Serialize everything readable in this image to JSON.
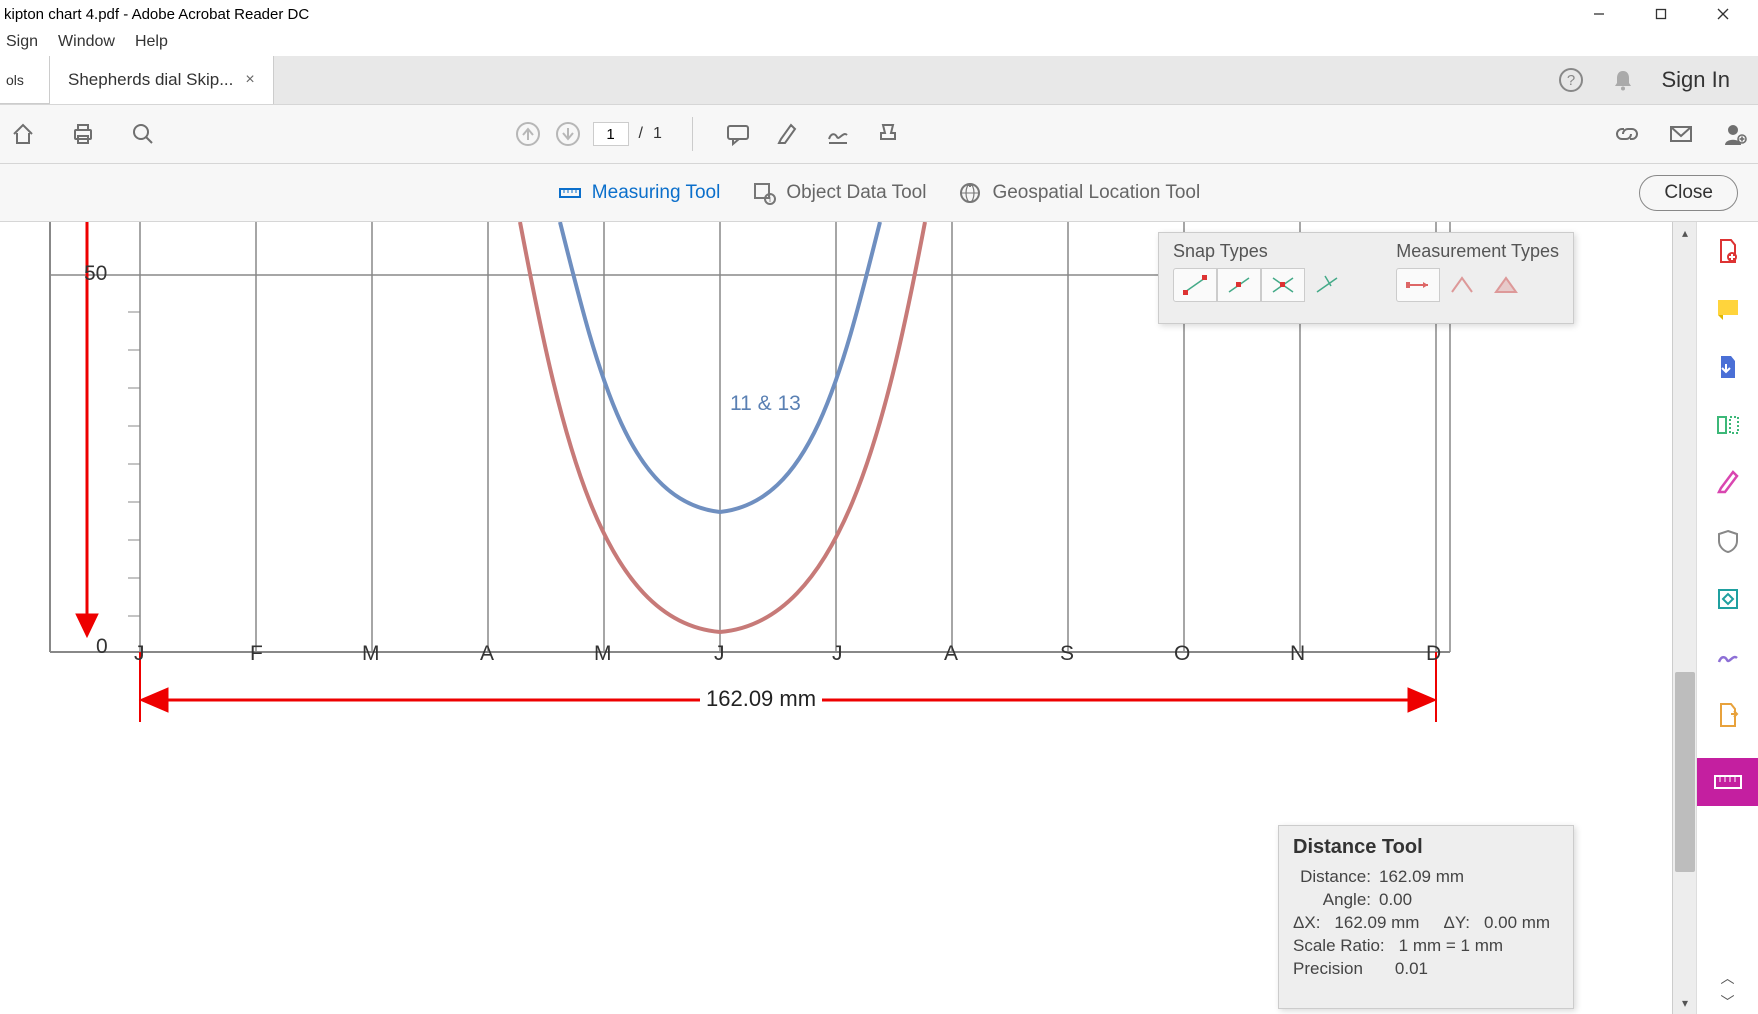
{
  "window": {
    "title": "kipton chart 4.pdf - Adobe Acrobat Reader DC"
  },
  "menu": {
    "sign": "Sign",
    "window": "Window",
    "help": "Help"
  },
  "tabs": {
    "partial": "ols",
    "active": "Shepherds dial Skip...",
    "sign_in": "Sign In"
  },
  "toolbar": {
    "page_current": "1",
    "page_total": "1",
    "page_sep": "/"
  },
  "measure_bar": {
    "measuring": "Measuring Tool",
    "object_data": "Object Data Tool",
    "geo": "Geospatial Location Tool",
    "close": "Close"
  },
  "snap": {
    "snap_title": "Snap Types",
    "meas_title": "Measurement Types"
  },
  "distance_panel": {
    "title": "Distance Tool",
    "distance_lab": "Distance:",
    "distance_val": "162.09 mm",
    "angle_lab": "Angle:",
    "angle_val": "0.00",
    "dx_lab": "ΔX:",
    "dx_val": "162.09 mm",
    "dy_lab": "ΔY:",
    "dy_val": "0.00 mm",
    "scale_lab": "Scale Ratio:",
    "scale_val": "1 mm = 1 mm",
    "prec_lab": "Precision",
    "prec_val": "0.01"
  },
  "chart_data": {
    "type": "line",
    "y_tick_visible": "50",
    "x_categories": [
      "J",
      "F",
      "M",
      "A",
      "M",
      "J",
      "J",
      "A",
      "S",
      "O",
      "N",
      "D"
    ],
    "curve_annotation": "11 & 13",
    "measurement_label": "162.09 mm",
    "series": [
      {
        "name": "blue",
        "color": "#6f8fc0",
        "min_month": "J_jun",
        "min_value_approx": 18
      },
      {
        "name": "red",
        "color": "#c77a78",
        "min_month": "J_jun",
        "min_value_approx": 3
      }
    ],
    "y_axis_visible_range": [
      0,
      60
    ]
  }
}
